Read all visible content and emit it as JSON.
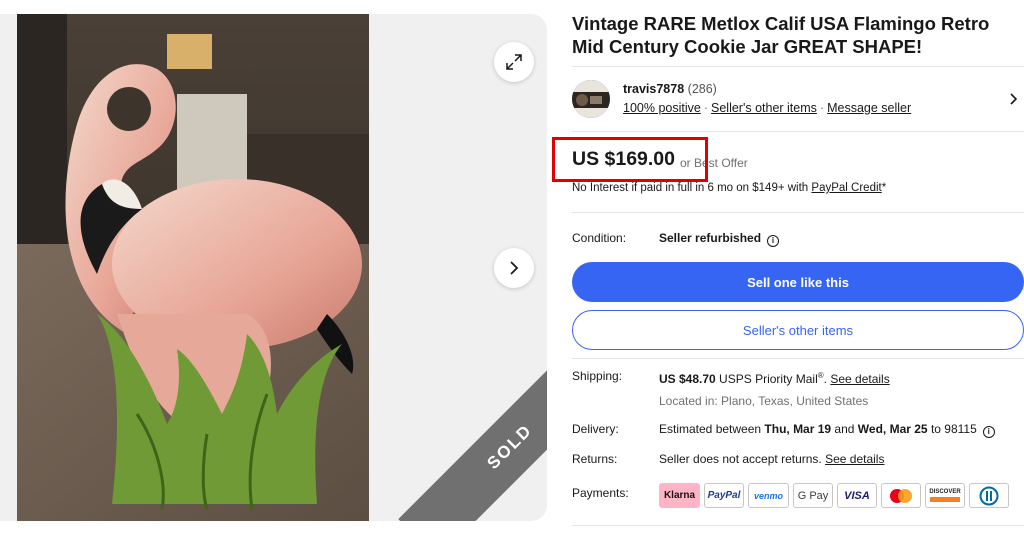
{
  "listing": {
    "title": "Vintage RARE Metlox Calif USA Flamingo Retro Mid Century Cookie Jar GREAT SHAPE!",
    "sold_ribbon": "SOLD"
  },
  "seller": {
    "name": "travis7878",
    "feedback_count": "(286)",
    "positive": "100% positive",
    "other_items": "Seller's other items",
    "message": "Message seller"
  },
  "price": {
    "amount": "US $169.00",
    "best_offer": "or Best Offer",
    "financing_text": "No Interest if paid in full in 6 mo on $149+ with ",
    "financing_link": "PayPal Credit",
    "financing_suffix": "*"
  },
  "condition": {
    "label": "Condition:",
    "value": "Seller refurbished"
  },
  "buttons": {
    "sell_one": "Sell one like this",
    "other_items": "Seller's other items"
  },
  "shipping": {
    "label": "Shipping:",
    "cost": "US $48.70",
    "service": " USPS Priority Mail",
    "reg": "®",
    "details_link": "See details",
    "location": "Located in: Plano, Texas, United States"
  },
  "delivery": {
    "label": "Delivery:",
    "prefix": "Estimated between ",
    "start": "Thu, Mar 19",
    "and": " and ",
    "end": "Wed, Mar 25",
    "suffix": " to 98115"
  },
  "returns": {
    "label": "Returns:",
    "text": "Seller does not accept returns. ",
    "details_link": "See details"
  },
  "payments": {
    "label": "Payments:",
    "methods": [
      "Klarna",
      "PayPal",
      "venmo",
      "G Pay",
      "VISA",
      "Mastercard",
      "DISCOVER",
      "Diners Club"
    ]
  },
  "colors": {
    "primary_blue": "#3665f3",
    "highlight_red": "#e00000",
    "muted_text": "#707070",
    "klarna_pink": "#ffb3c7"
  },
  "icons": {
    "expand": "expand-icon",
    "next": "chevron-right-icon",
    "seller_chevron": "chevron-right-icon",
    "info": "info-icon"
  }
}
